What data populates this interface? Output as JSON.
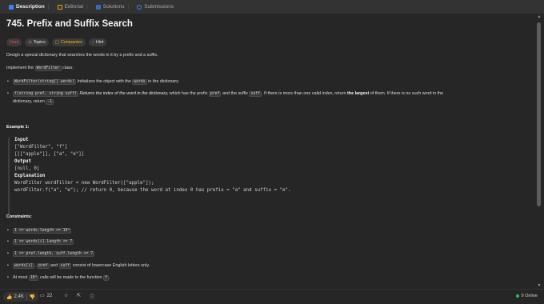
{
  "tabs": [
    {
      "label": "Description",
      "icon": "description-icon"
    },
    {
      "label": "Editorial",
      "icon": "editorial-icon"
    },
    {
      "label": "Solutions",
      "icon": "solutions-icon"
    },
    {
      "label": "Submissions",
      "icon": "submissions-icon"
    }
  ],
  "problem": {
    "title": "745. Prefix and Suffix Search",
    "tags": {
      "difficulty": "Hard",
      "topics": "Topics",
      "companies": "Companies",
      "hint": "Hint"
    },
    "intro": "Design a special dictionary that searches the words in it by a prefix and a suffix.",
    "implement_pre": "Implement the ",
    "implement_code": "WordFilter",
    "implement_post": " class:",
    "b1_code": "WordFilter(string[] words)",
    "b1_text_a": " Initializes the object with the ",
    "b1_code2": "words",
    "b1_text_b": " in the dictionary.",
    "b2_code": "f(string pref, string suff)",
    "b2_italic": " Returns the index of the word in the dictionary,",
    "b2_text_a": " which has the prefix ",
    "b2_code2": "pref",
    "b2_text_b": " and the suffix ",
    "b2_code3": "suff",
    "b2_text_c": ". If there is more than one valid index, return ",
    "b2_bold": "the largest",
    "b2_text_d": " of them. If there is no such word in the",
    "b2_line2_a": "dictionary, return ",
    "b2_line2_code": "-1",
    "b2_line2_b": "."
  },
  "example": {
    "heading": "Example 1:",
    "input_label": "Input",
    "input_line1": "[\"WordFilter\", \"f\"]",
    "input_line2": "[[[\"apple\"]], [\"a\", \"e\"]]",
    "output_label": "Output",
    "output_value": "[null, 0]",
    "explanation_label": "Explanation",
    "expl_line1": "WordFilter wordFilter = new WordFilter([\"apple\"]);",
    "expl_line2": "wordFilter.f(\"a\", \"e\"); // return 0, because the word at index 0 has prefix = \"a\" and suffix = \"e\"."
  },
  "constraints": {
    "heading": "Constraints:",
    "c1": "1 <= words.length <= 10⁴",
    "c2": "1 <= words[i].length <= 7",
    "c3": "1 <= pref.length, suff.length <= 7",
    "c4_code1": "words[i]",
    "c4_sep": ", ",
    "c4_code2": "pref",
    "c4_and": " and ",
    "c4_code3": "suff",
    "c4_text": " consist of lowercase English letters only.",
    "c5_pre": "At most ",
    "c5_code": "10⁴",
    "c5_mid": " calls will be made to the function ",
    "c5_code2": "f",
    "c5_post": "."
  },
  "bottom": {
    "likes": "2.4K",
    "comments": "22",
    "online": "9 Online"
  },
  "colors": {
    "hard": "#ef4743",
    "companies": "#ffb800",
    "accent": "#3b82f6",
    "online_dot": "#2cbb5d"
  }
}
